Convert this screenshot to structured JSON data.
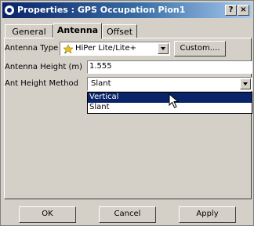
{
  "window": {
    "title": "Properties : GPS Occupation Pion1",
    "help_label": "?",
    "close_label": "×"
  },
  "tabs": [
    {
      "label": "General",
      "active": false
    },
    {
      "label": "Antenna",
      "active": true
    },
    {
      "label": "Offset",
      "active": false
    }
  ],
  "antenna": {
    "type_label": "Antenna Type",
    "type_value": "HiPer Lite/Lite+",
    "custom_button": "Custom....",
    "height_label": "Antenna Height (m)",
    "height_value": "1.555",
    "method_label": "Ant Height Method",
    "method_value": "Slant",
    "method_options": [
      {
        "label": "Vertical",
        "highlighted": true
      },
      {
        "label": "Slant",
        "highlighted": false
      }
    ]
  },
  "buttons": {
    "ok": "OK",
    "cancel": "Cancel",
    "apply": "Apply"
  },
  "colors": {
    "title_bar": "#0a246a",
    "selection": "#0a246a",
    "face": "#d4d0c8"
  },
  "icons": {
    "title": "app-icon",
    "antenna": "antenna-icon",
    "cursor": "mouse-pointer-icon"
  }
}
